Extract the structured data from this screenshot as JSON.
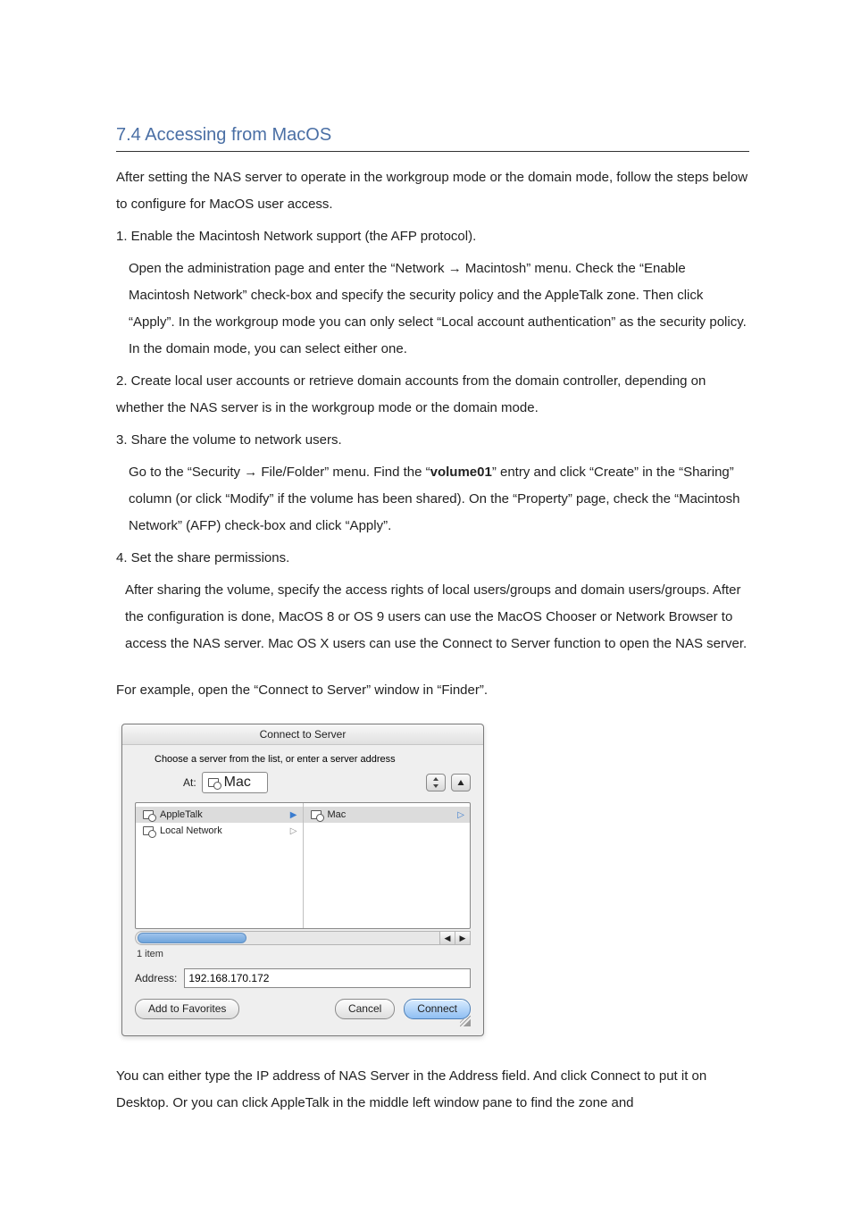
{
  "heading": "7.4 Accessing from MacOS",
  "para_intro": "After setting the NAS server to operate in the workgroup mode or the domain mode, follow the steps below to configure for MacOS user access.",
  "step1_line1": "1. Enable the Macintosh Network support (the AFP protocol).",
  "step1_line2": "Open the administration page and enter the “Network → Macintosh” menu. Check the “Enable Macintosh Network” check-box and specify the security policy and the AppleTalk zone. Then click “Apply”. In the workgroup mode you can only select “Local account authentication” as the security policy. In the domain mode, you can select either one.",
  "step2": "2. Create local user accounts or retrieve domain accounts from the domain controller, depending on whether the NAS server is in the workgroup mode or the domain mode.",
  "step3_line1": "3. Share the volume to network users.",
  "step3_pre": "Go to the “Security → File/Folder” menu. Find the “",
  "step3_bold": "volume01",
  "step3_post": "” entry and click “Create” in the “Sharing” column (or click “Modify” if the volume has been shared). On the “Property” page, check the “Macintosh Network” (AFP) check-box and click “Apply”.",
  "step4_line1": "4. Set the share permissions.",
  "step4_line2": "After sharing the volume, specify the access rights of local users/groups and domain users/groups. After the configuration is done, MacOS 8 or OS 9 users can use the MacOS Chooser or Network Browser to access the NAS server. Mac OS X users can use the Connect to Server function to open the NAS server.",
  "example_line": "For example, open the “Connect to Server” window in “Finder”.",
  "closing": "You can either type the IP address of NAS Server in the Address field. And click Connect to put it on Desktop. Or you can click AppleTalk in the middle left window pane to find the zone and",
  "dialog": {
    "title": "Connect to Server",
    "instruction": "Choose a server from the list, or enter a server address",
    "at_label": "At:",
    "at_value": "Mac",
    "left_items": [
      {
        "label": "AppleTalk",
        "selected": true
      },
      {
        "label": "Local Network",
        "selected": false
      }
    ],
    "right_items": [
      {
        "label": "Mac",
        "selected": true
      }
    ],
    "count_text": "1 item",
    "address_label": "Address:",
    "address_value": "192.168.170.172",
    "btn_fav": "Add to Favorites",
    "btn_cancel": "Cancel",
    "btn_connect": "Connect"
  }
}
